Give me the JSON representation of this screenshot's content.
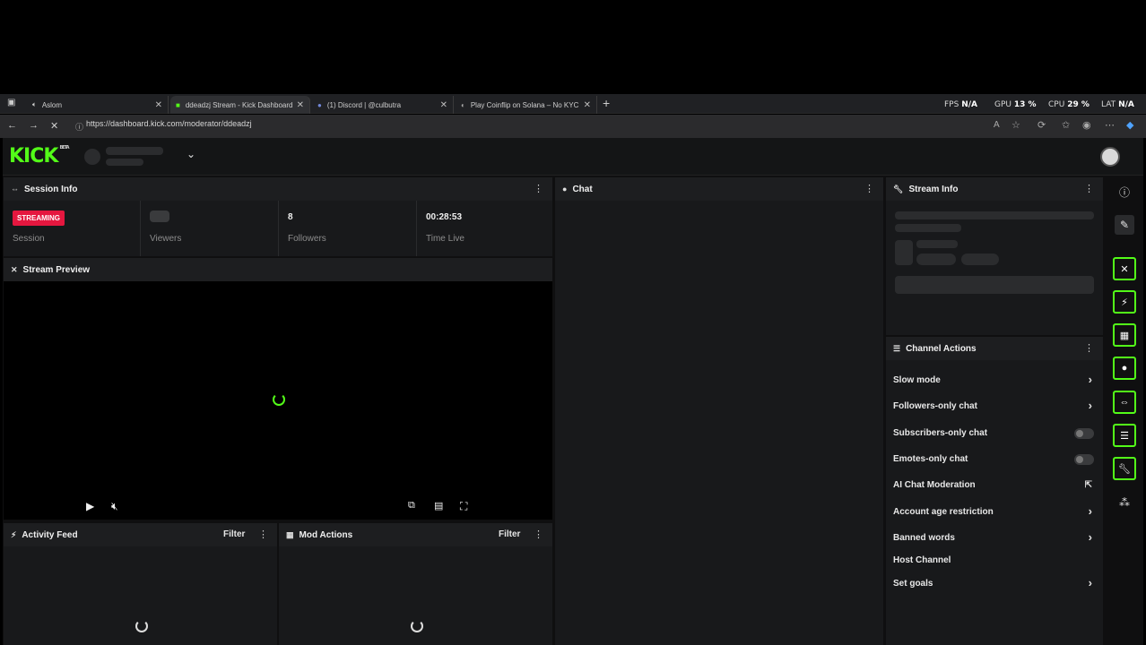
{
  "browser": {
    "tabs": [
      {
        "title": "Aslom",
        "icon": "speaker-icon"
      },
      {
        "title": "ddeadzj Stream - Kick Dashboard",
        "icon": "kick-icon"
      },
      {
        "title": "(1) Discord | @culbutra",
        "icon": "discord-icon"
      },
      {
        "title": "Play Coinflip on Solana – No KYC",
        "icon": "coin-icon"
      }
    ],
    "new_tab": "+",
    "url": "https://dashboard.kick.com/moderator/ddeadzj",
    "perf": {
      "fps_label": "FPS",
      "fps_value": "N/A",
      "gpu_label": "GPU",
      "gpu_value": "13 %",
      "cpu_label": "CPU",
      "cpu_value": "29 %",
      "lat_label": "LAT",
      "lat_value": "N/A"
    }
  },
  "app": {
    "logo": "KICK",
    "logo_tag": "BETA",
    "accent": "#53fc18"
  },
  "session_info": {
    "title": "Session Info",
    "status_badge": "STREAMING",
    "status_label": "Session",
    "viewers_label": "Viewers",
    "followers_value": "8",
    "followers_label": "Followers",
    "time_value": "00:28:53",
    "time_label": "Time Live"
  },
  "stream_preview": {
    "title": "Stream Preview"
  },
  "chat": {
    "title": "Chat"
  },
  "stream_info": {
    "title": "Stream Info"
  },
  "activity_feed": {
    "title": "Activity Feed",
    "filter": "Filter"
  },
  "mod_actions": {
    "title": "Mod Actions",
    "filter": "Filter"
  },
  "channel_actions": {
    "title": "Channel Actions",
    "items": [
      {
        "label": "Slow mode",
        "control": "chevron"
      },
      {
        "label": "Followers-only chat",
        "control": "chevron"
      },
      {
        "label": "Subscribers-only chat",
        "control": "toggle",
        "on": false
      },
      {
        "label": "Emotes-only chat",
        "control": "toggle",
        "on": false
      },
      {
        "label": "AI Chat Moderation",
        "control": "external"
      },
      {
        "label": "Account age restriction",
        "control": "chevron"
      },
      {
        "label": "Banned words",
        "control": "chevron"
      },
      {
        "label": "Host Channel",
        "control": "none"
      },
      {
        "label": "Set goals",
        "control": "chevron"
      }
    ]
  }
}
